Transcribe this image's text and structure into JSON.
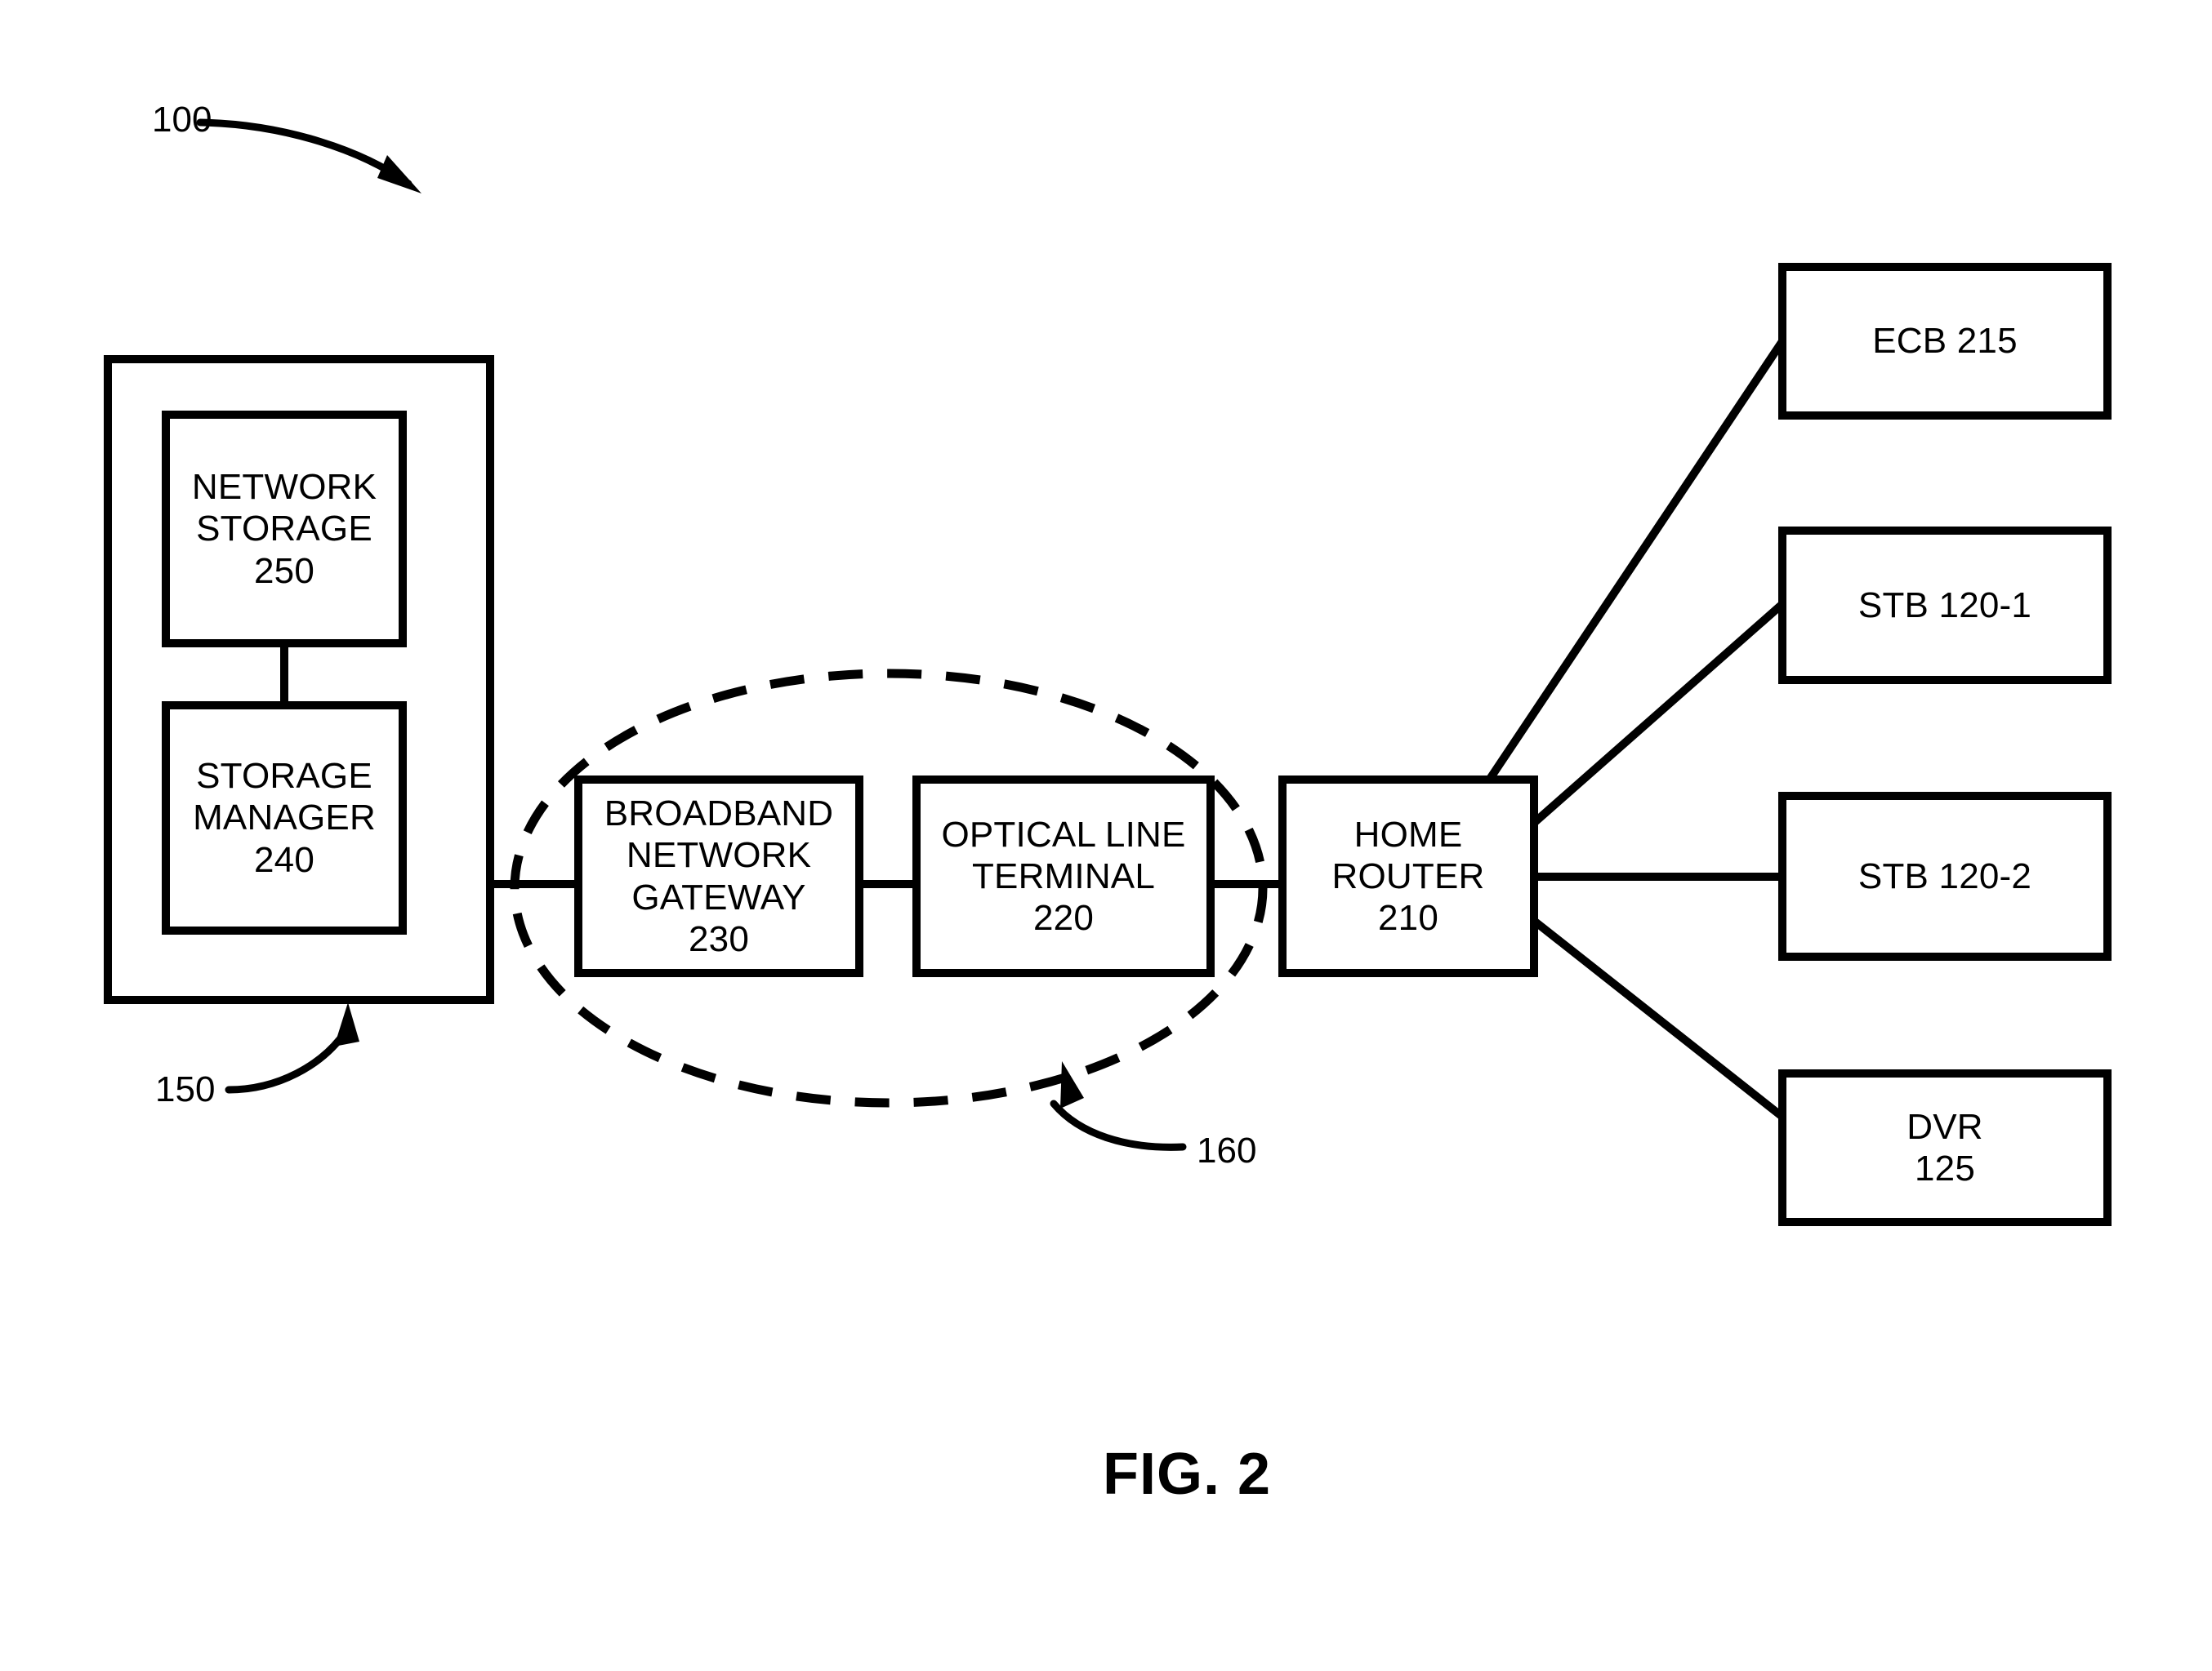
{
  "figure": {
    "caption": "FIG. 2",
    "system_ref": "100"
  },
  "reference_labels": {
    "system": "100",
    "network_side": "150",
    "access_network": "160"
  },
  "containers": {
    "network_side": {
      "ref": "150",
      "components": [
        {
          "name": "NETWORK STORAGE",
          "ref": "250",
          "lines": [
            "NETWORK",
            "STORAGE",
            "250"
          ]
        },
        {
          "name": "STORAGE MANAGER",
          "ref": "240",
          "lines": [
            "STORAGE",
            "MANAGER",
            "240"
          ]
        }
      ]
    },
    "access_network": {
      "ref": "160",
      "style": "dashed-ellipse",
      "components": [
        {
          "name": "BROADBAND NETWORK GATEWAY",
          "ref": "230",
          "lines": [
            "BROADBAND",
            "NETWORK",
            "GATEWAY",
            "230"
          ]
        },
        {
          "name": "OPTICAL LINE TERMINAL",
          "ref": "220",
          "lines": [
            "OPTICAL LINE",
            "TERMINAL",
            "220"
          ]
        }
      ]
    }
  },
  "home_network": {
    "router": {
      "name": "HOME ROUTER",
      "ref": "210",
      "lines": [
        "HOME",
        "ROUTER",
        "210"
      ]
    },
    "devices": [
      {
        "name": "ECB",
        "ref": "215",
        "lines": [
          "ECB 215"
        ]
      },
      {
        "name": "STB",
        "ref": "120-1",
        "lines": [
          "STB 120-1"
        ]
      },
      {
        "name": "STB",
        "ref": "120-2",
        "lines": [
          "STB 120-2"
        ]
      },
      {
        "name": "DVR",
        "ref": "125",
        "lines": [
          "DVR",
          "125"
        ]
      }
    ]
  },
  "colors": {
    "stroke": "#000000",
    "background": "#ffffff"
  }
}
